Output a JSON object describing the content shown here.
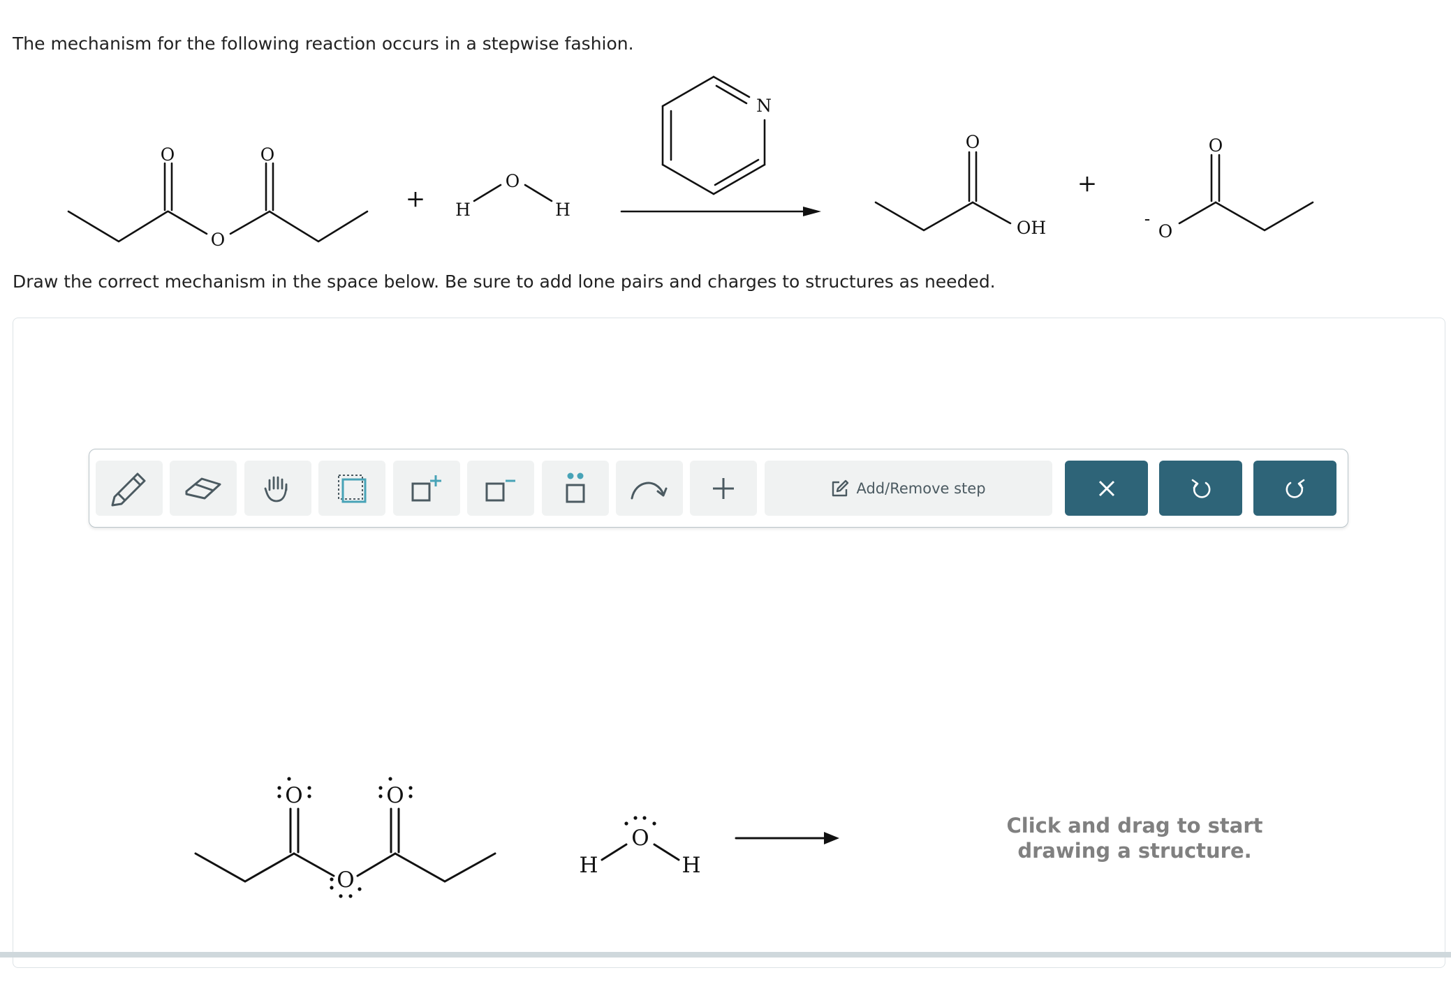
{
  "question": {
    "intro_text": "The mechanism for the following reaction occurs in a stepwise fashion.",
    "instruction_text": "Draw the correct mechanism in the space below. Be sure to add lone pairs and charges to structures as needed."
  },
  "reaction": {
    "atom_O": "O",
    "atom_H": "H",
    "atom_N": "N",
    "group_OH": "OH",
    "plus": "+",
    "minus": "-"
  },
  "toolbar": {
    "add_remove_step_label": "Add/Remove step",
    "tools": [
      "pencil-icon",
      "eraser-icon",
      "hand-icon",
      "select-box-icon",
      "positive-charge-icon",
      "negative-charge-icon",
      "lone-pair-icon",
      "curved-arrow-icon",
      "plus-icon",
      "edit-icon",
      "close-icon",
      "undo-icon",
      "redo-icon"
    ],
    "accent_color": "#2e6478",
    "teal_color": "#47a3b7"
  },
  "canvas": {
    "hint_line1": "Click and drag to start",
    "hint_line2": "drawing a structure."
  }
}
